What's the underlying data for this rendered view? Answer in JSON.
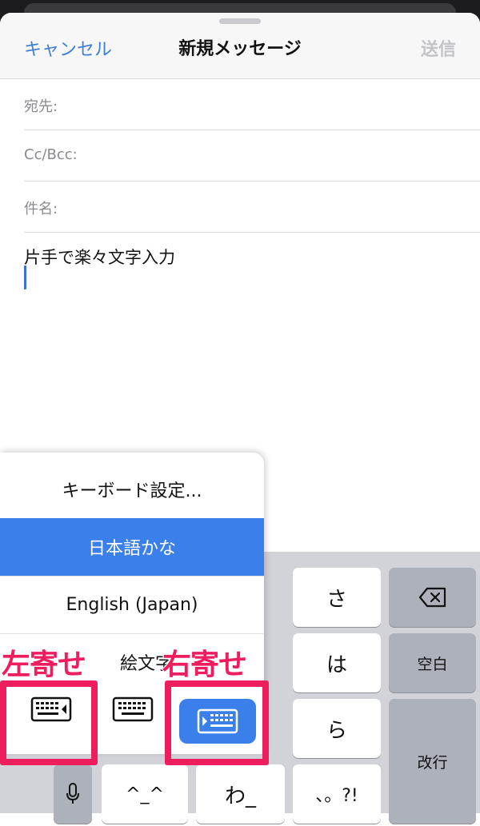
{
  "header": {
    "cancel_label": "キャンセル",
    "title": "新規メッセージ",
    "send_label": "送信"
  },
  "fields": {
    "to_label": "宛先:",
    "cc_label": "Cc/Bcc:",
    "subject_label": "件名:"
  },
  "body_text": "片手で楽々文字入力",
  "keyboard": {
    "keys": {
      "sa": "さ",
      "ha": "は",
      "ra": "ら",
      "wa": "わ_",
      "punct": "、。?!",
      "emoticon": "^_^",
      "space": "空白",
      "return": "改行"
    }
  },
  "menu": {
    "items": [
      "キーボード設定...",
      "日本語かな",
      "English (Japan)",
      "絵文字"
    ],
    "selected": "日本語かな"
  },
  "annotations": {
    "left_label": "左寄せ",
    "right_label": "右寄せ",
    "color": "#ee1d5e"
  },
  "colors": {
    "accent": "#3b80ea",
    "link": "#3d7fd6"
  }
}
